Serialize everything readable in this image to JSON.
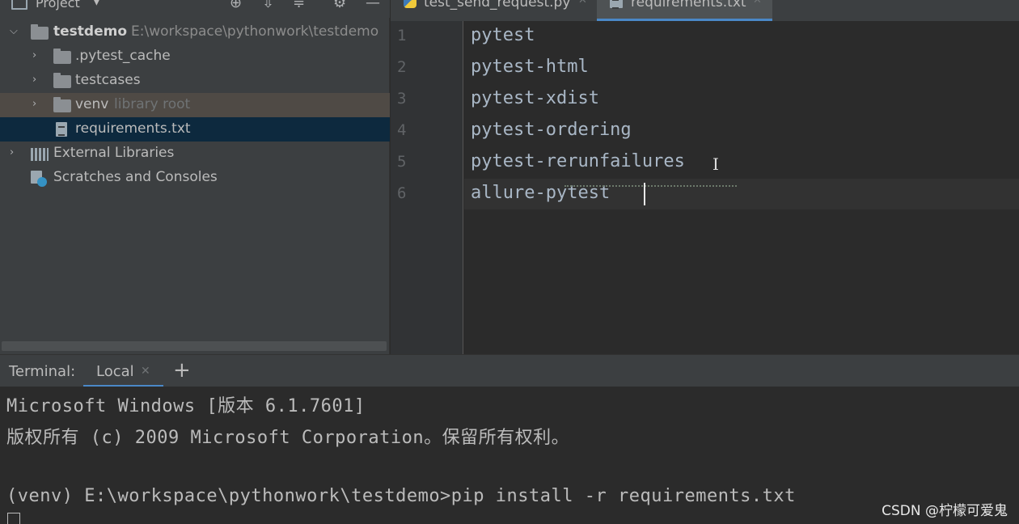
{
  "project_panel": {
    "title": "Project",
    "tree": {
      "root": {
        "name": "testdemo",
        "path": "E:\\workspace\\pythonwork\\testdemo"
      },
      "pytest_cache": ".pytest_cache",
      "testcases": "testcases",
      "venv": {
        "name": "venv",
        "hint": "library root"
      },
      "requirements": "requirements.txt",
      "external_libraries": "External Libraries",
      "scratches": "Scratches and Consoles"
    }
  },
  "editor": {
    "tabs": [
      {
        "label": "test_send_request.py"
      },
      {
        "label": "requirements.txt"
      }
    ],
    "line_numbers": [
      "1",
      "2",
      "3",
      "4",
      "5",
      "6"
    ],
    "lines": [
      "pytest",
      "pytest-html",
      "pytest-xdist",
      "pytest-ordering",
      "pytest-rerunfailures",
      "allure-pytest"
    ]
  },
  "terminal": {
    "label": "Terminal:",
    "tab": "Local",
    "new_tab": "+",
    "lines": [
      "Microsoft Windows [版本 6.1.7601]",
      "版权所有 (c) 2009 Microsoft Corporation。保留所有权利。",
      "(venv) E:\\workspace\\pythonwork\\testdemo>pip install -r requirements.txt"
    ]
  },
  "watermark": "CSDN @柠檬可爱鬼",
  "colors": {
    "panel_bg": "#3c3f41",
    "editor_bg": "#2b2b2b",
    "selection": "#0d293e",
    "accent": "#4a88c7",
    "code_text": "#a9b7c6"
  }
}
